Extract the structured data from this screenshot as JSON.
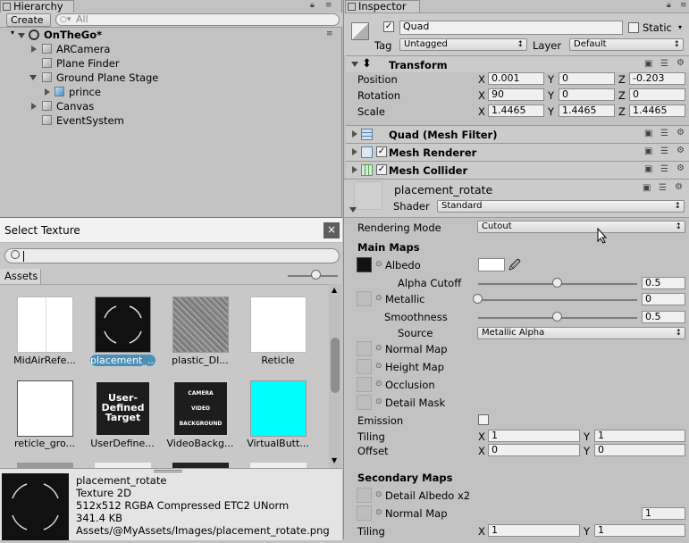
{
  "hierarchy": {
    "tab": "Hierarchy",
    "create": "Create",
    "search_placeholder": "All",
    "scene": "OnTheGo*",
    "items": [
      "ARCamera",
      "Plane Finder",
      "Ground Plane Stage",
      "prince",
      "Canvas",
      "EventSystem"
    ]
  },
  "select_texture": {
    "title": "Select Texture",
    "close": "×",
    "tab": "Assets",
    "thumbs": [
      "MidAirRefe...",
      "placement_...",
      "plastic_DI...",
      "Reticle",
      "reticle_gro...",
      "UserDefine...",
      "VideoBackg...",
      "VirtualButt..."
    ],
    "thumb_texts": {
      "user": "User-\nDefined\nTarget",
      "video_top": "CAMERA",
      "video_mid": "VIDEO",
      "video_bot": "BACKGROUND"
    },
    "info": {
      "name": "placement_rotate",
      "type": "Texture 2D",
      "format": "512x512  RGBA Compressed ETC2 UNorm",
      "size": "341.4 KB",
      "path": "Assets/@MyAssets/Images/placement_rotate.png"
    }
  },
  "inspector": {
    "tab": "Inspector",
    "object_name": "Quad",
    "static_label": "Static",
    "tag_label": "Tag",
    "tag_value": "Untagged",
    "layer_label": "Layer",
    "layer_value": "Default",
    "transform": {
      "title": "Transform",
      "rows": [
        {
          "label": "Position",
          "x": "0.001",
          "y": "0",
          "z": "-0.203"
        },
        {
          "label": "Rotation",
          "x": "90",
          "y": "0",
          "z": "0"
        },
        {
          "label": "Scale",
          "x": "1.4465",
          "y": "1.4465",
          "z": "1.4465"
        }
      ]
    },
    "mesh_filter": "Quad (Mesh Filter)",
    "mesh_renderer": "Mesh Renderer",
    "mesh_collider": "Mesh Collider",
    "material": {
      "name": "placement_rotate",
      "shader_label": "Shader",
      "shader_value": "Standard",
      "rendering_mode_label": "Rendering Mode",
      "rendering_mode_value": "Cutout",
      "main_maps": "Main Maps",
      "albedo": "Albedo",
      "alpha_cutoff": "Alpha Cutoff",
      "alpha_cutoff_value": "0.5",
      "metallic": "Metallic",
      "metallic_value": "0",
      "smoothness": "Smoothness",
      "smoothness_value": "0.5",
      "source": "Source",
      "source_value": "Metallic Alpha",
      "normal_map": "Normal Map",
      "height_map": "Height Map",
      "occlusion": "Occlusion",
      "detail_mask": "Detail Mask",
      "emission": "Emission",
      "tiling": "Tiling",
      "offset": "Offset",
      "tiling_x": "1",
      "tiling_y": "1",
      "offset_x": "0",
      "offset_y": "0",
      "secondary_maps": "Secondary Maps",
      "detail_albedo": "Detail Albedo x2",
      "normal_map2": "Normal Map",
      "normal_map2_value": "1",
      "tiling2_x": "1",
      "tiling2_y": "1",
      "sliders": {
        "alpha_cutoff": 0.5,
        "metallic": 0,
        "smoothness": 0.5
      }
    }
  }
}
